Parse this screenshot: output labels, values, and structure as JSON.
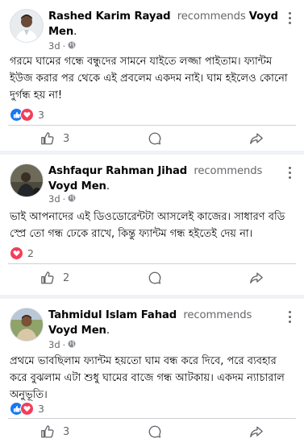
{
  "posts": [
    {
      "author": "Rashed Karim Rayad",
      "verb": "recommends",
      "page": "Voyd Men",
      "time": "3d",
      "dot": "·",
      "text": "গরমে ঘামের গন্ধে বন্ধুদের সামনে যাইতে লজ্জা পাইতাম। ফ্যান্টম ইউজ করার পর থেকে এই প্রবলেম একদম নাই। ঘাম হইলেও কোনো দুর্গন্ধ হয় না!",
      "reactions": [
        "like",
        "love"
      ],
      "reaction_count": "3",
      "like_count": "3"
    },
    {
      "author": "Ashfaqur Rahman Jihad",
      "verb": "recommends",
      "page": "Voyd Men",
      "time": "3d",
      "dot": "·",
      "text": "ভাই আপনাদের এই ডিওডোরেন্টটা আসলেই কাজের। সাধারণ বডি স্প্রে তো গন্ধ ঢেকে রাখে, কিন্তু ফ্যান্টম গন্ধ হইতেই দেয় না।",
      "reactions": [
        "love"
      ],
      "reaction_count": "2",
      "like_count": "2"
    },
    {
      "author": "Tahmidul Islam Fahad",
      "verb": "recommends",
      "page": "Voyd Men",
      "time": "3d",
      "dot": "·",
      "text": "প্রথমে ভাবছিলাম ফ্যান্টম হয়তো ঘাম বন্ধ করে দিবে, পরে ব্যবহার করে বুঝলাম এটা শুধু ঘামের বাজে গন্ধ আটকায়। একদম ন্যাচারাল অনুভূতি।",
      "reactions": [
        "like",
        "love"
      ],
      "reaction_count": "3",
      "like_count": "3"
    }
  ],
  "icons": {
    "like": "thumbs-up-icon",
    "comment": "comment-bubble-icon",
    "share": "share-arrow-icon",
    "audience": "globe-icon",
    "more": "more-options-icon"
  },
  "colors": {
    "like_blue": "#1877f2",
    "love_red": "#f33e58",
    "secondary_text": "#65676b",
    "feed_background": "#f0f2f5"
  }
}
